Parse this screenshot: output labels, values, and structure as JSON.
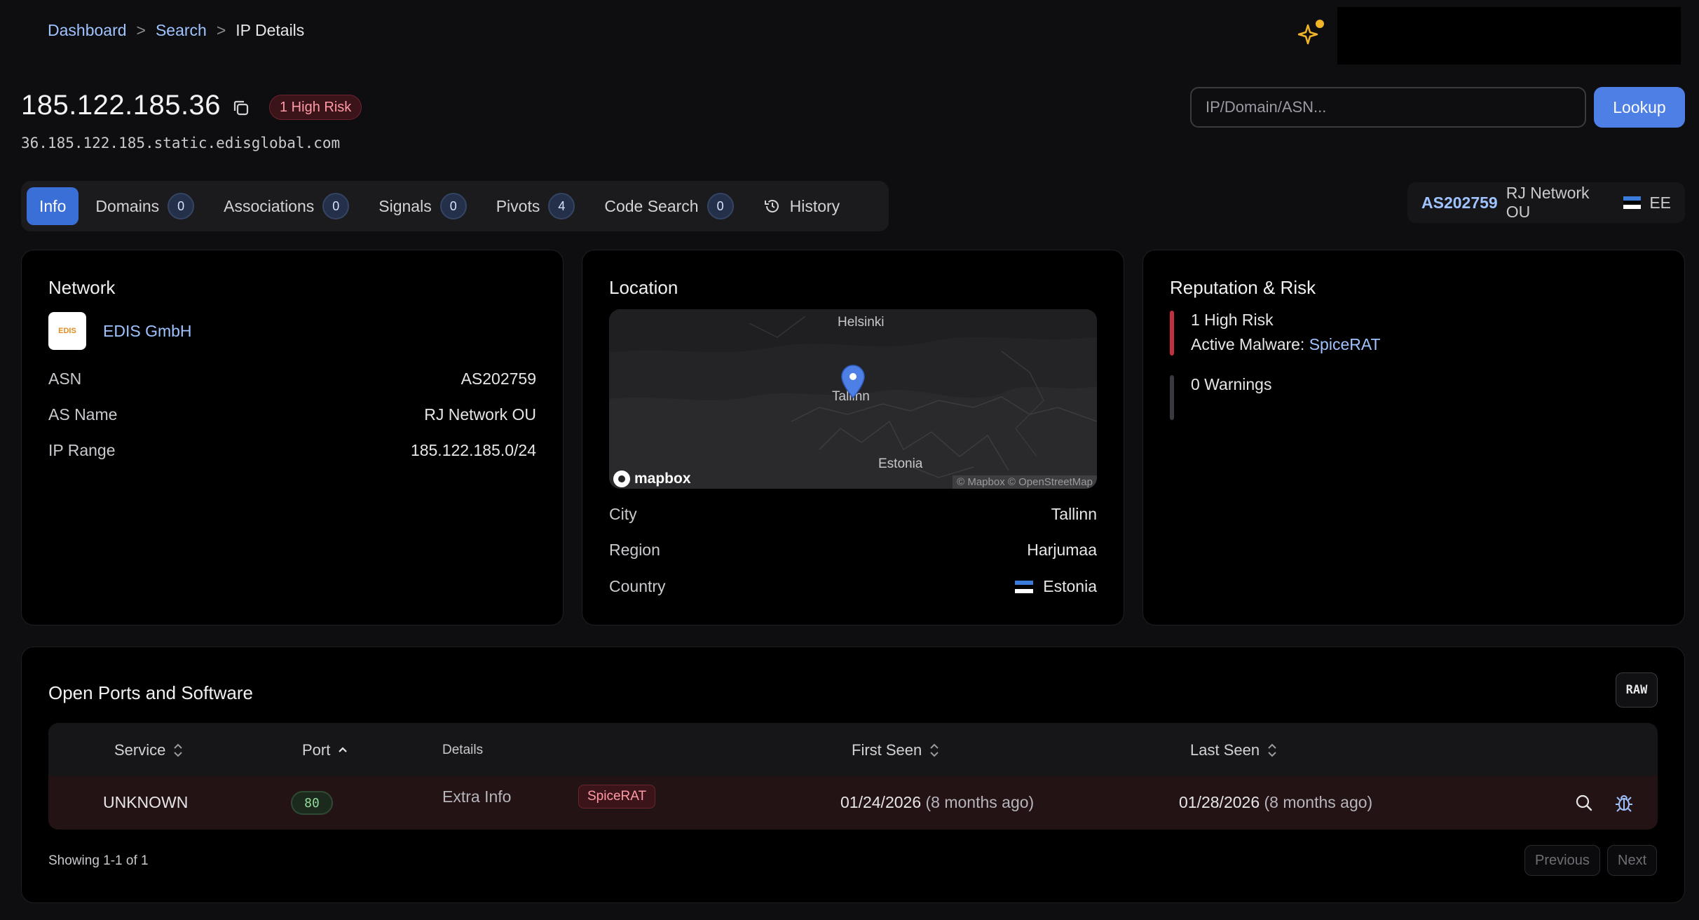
{
  "breadcrumb": {
    "items": [
      "Dashboard",
      "Search"
    ],
    "separator": ">",
    "current": "IP Details"
  },
  "header": {
    "ip": "185.122.185.36",
    "risk_badge": "1 High Risk",
    "hostname": "36.185.122.185.static.edisglobal.com",
    "search_placeholder": "IP/Domain/ASN...",
    "lookup_label": "Lookup"
  },
  "tabs": [
    {
      "label": "Info",
      "active": true
    },
    {
      "label": "Domains",
      "count": "0"
    },
    {
      "label": "Associations",
      "count": "0"
    },
    {
      "label": "Signals",
      "count": "0"
    },
    {
      "label": "Pivots",
      "count": "4"
    },
    {
      "label": "Code Search",
      "count": "0"
    },
    {
      "label": "History",
      "icon": "history-icon"
    }
  ],
  "asn_pill": {
    "asn": "AS202759",
    "name": "RJ Network OU",
    "country_code": "EE"
  },
  "network": {
    "title": "Network",
    "org_name": "EDIS GmbH",
    "logo_text": "EDIS",
    "rows": [
      {
        "label": "ASN",
        "value": "AS202759",
        "link": true
      },
      {
        "label": "AS Name",
        "value": "RJ Network OU",
        "link": false
      },
      {
        "label": "IP Range",
        "value": "185.122.185.0/24",
        "link": true
      }
    ]
  },
  "location": {
    "title": "Location",
    "map": {
      "labels": [
        "Helsinki",
        "Tallinn",
        "Estonia"
      ],
      "brand": "mapbox",
      "attribution": "© Mapbox © OpenStreetMap"
    },
    "rows": [
      {
        "label": "City",
        "value": "Tallinn"
      },
      {
        "label": "Region",
        "value": "Harjumaa"
      },
      {
        "label": "Country",
        "value": "Estonia"
      }
    ]
  },
  "reputation": {
    "title": "Reputation & Risk",
    "high_risk": "1 High Risk",
    "malware_prefix": "Active Malware: ",
    "malware_name": "SpiceRAT",
    "warnings": "0 Warnings",
    "colors": {
      "risk": "#c0303f",
      "warning": "#3a3a3e"
    }
  },
  "ports": {
    "title": "Open Ports and Software",
    "raw_label": "RAW",
    "columns": {
      "service": "Service",
      "port": "Port",
      "details": "Details",
      "first_seen": "First Seen",
      "last_seen": "Last Seen"
    },
    "rows": [
      {
        "service": "UNKNOWN",
        "port": "80",
        "details_label": "Extra Info",
        "tag": "SpiceRAT",
        "first_seen_date": "01/24/2026",
        "first_seen_rel": "(8 months ago)",
        "last_seen_date": "01/28/2026",
        "last_seen_rel": "(8 months ago)"
      }
    ],
    "showing": "Showing 1-1 of 1",
    "prev_label": "Previous",
    "next_label": "Next"
  },
  "colors": {
    "accent": "#4e7fe5",
    "link": "#9fc3ff",
    "danger": "#ff9aa6"
  }
}
